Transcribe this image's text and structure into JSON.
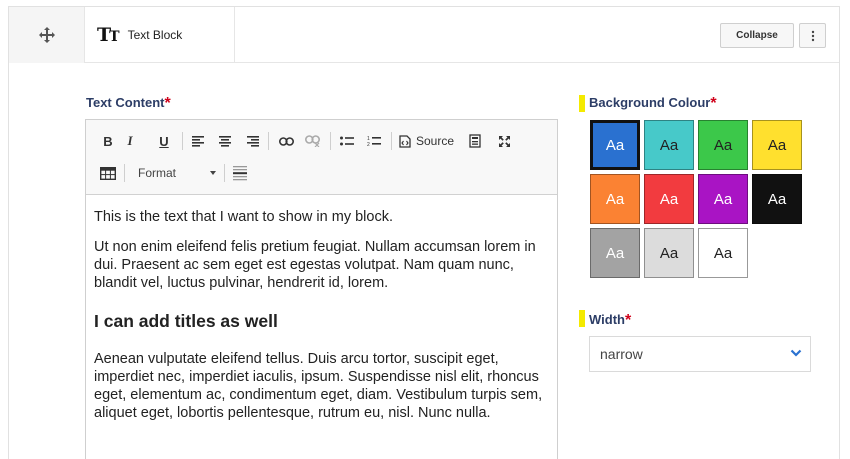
{
  "header": {
    "block_type_label": "Text Block",
    "block_type_icon": "text-size-icon",
    "block_type_icon_text": "T",
    "block_type_icon_small": "T",
    "collapse_label": "Collapse",
    "more_icon": "vertical-ellipsis-icon",
    "drag_icon": "move-arrows-icon"
  },
  "text_content": {
    "label": "Text Content",
    "required_mark": "*",
    "toolbar": {
      "bold": "B",
      "italic": "I",
      "underline": "U",
      "source_label": "Source",
      "format_label": "Format",
      "icons": [
        "align-left-icon",
        "align-center-icon",
        "align-right-icon",
        "link-icon",
        "unlink-icon",
        "bulleted-list-icon",
        "numbered-list-icon",
        "source-icon",
        "show-blocks-icon",
        "maximize-icon",
        "table-icon",
        "horizontal-rule-icon"
      ]
    },
    "paragraphs": [
      "This is the text that I want to show in my block.",
      "Ut non enim eleifend felis pretium feugiat. Nullam accumsan lorem in dui. Praesent ac sem eget est egestas volutpat. Nam quam nunc, blandit vel, luctus pulvinar, hendrerit id, lorem."
    ],
    "heading": "I can add titles as well",
    "paragraph_after": "Aenean vulputate eleifend tellus. Duis arcu tortor, suscipit eget, imperdiet nec, imperdiet iaculis, ipsum. Suspendisse nisl elit, rhoncus eget, elementum ac, condimentum eget, diam. Vestibulum turpis sem, aliquet eget, lobortis pellentesque, rutrum eu, nisl. Nunc nulla."
  },
  "background_colour": {
    "label": "Background Colour",
    "required_mark": "*",
    "swatches": [
      {
        "text": "Aa",
        "bg": "#2a71d0",
        "fg": "#ffffff",
        "selected": true
      },
      {
        "text": "Aa",
        "bg": "#47c9c9",
        "fg": "#222222",
        "selected": false
      },
      {
        "text": "Aa",
        "bg": "#3cc84a",
        "fg": "#222222",
        "selected": false
      },
      {
        "text": "Aa",
        "bg": "#ffe02e",
        "fg": "#222222",
        "selected": false
      },
      {
        "text": "Aa",
        "bg": "#fb8233",
        "fg": "#ffffff",
        "selected": false
      },
      {
        "text": "Aa",
        "bg": "#f23b3f",
        "fg": "#ffffff",
        "selected": false
      },
      {
        "text": "Aa",
        "bg": "#a914c4",
        "fg": "#ffffff",
        "selected": false
      },
      {
        "text": "Aa",
        "bg": "#111111",
        "fg": "#ffffff",
        "selected": false
      },
      {
        "text": "Aa",
        "bg": "#a3a3a3",
        "fg": "#ffffff",
        "selected": false
      },
      {
        "text": "Aa",
        "bg": "#dcdcdc",
        "fg": "#222222",
        "selected": false
      },
      {
        "text": "Aa",
        "bg": "#ffffff",
        "fg": "#222222",
        "selected": false
      }
    ]
  },
  "width": {
    "label": "Width",
    "required_mark": "*",
    "value": "narrow",
    "chevron_icon": "chevron-down-icon"
  },
  "colors": {
    "label_text": "#2c3d66",
    "required": "#d0021b",
    "label_marker": "#f4ea00",
    "chevron": "#2a71d0"
  }
}
